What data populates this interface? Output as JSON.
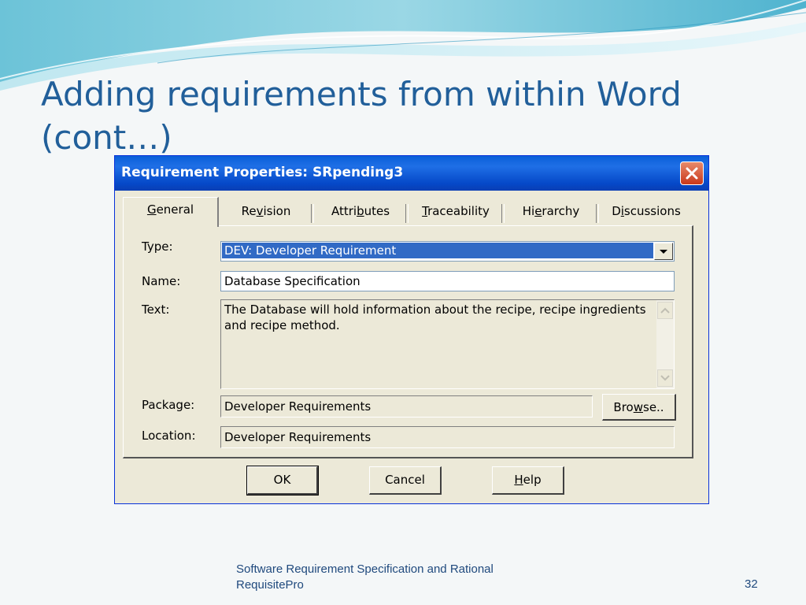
{
  "slide": {
    "title_line1": "Adding requirements from within Word",
    "title_line2": "(cont…)",
    "footer_line1": "Software Requirement Specification and Rational",
    "footer_line2": "RequisitePro",
    "page_number": "32"
  },
  "dialog": {
    "title": "Requirement Properties: SRpending3",
    "tabs": [
      {
        "label": "General",
        "underline": "G",
        "rest": "eneral",
        "pre": ""
      },
      {
        "label": "Revision",
        "pre": "Re",
        "underline": "v",
        "rest": "ision"
      },
      {
        "label": "Attributes",
        "pre": "Attri",
        "underline": "b",
        "rest": "utes"
      },
      {
        "label": "Traceability",
        "pre": "",
        "underline": "T",
        "rest": "raceability"
      },
      {
        "label": "Hierarchy",
        "pre": "Hi",
        "underline": "e",
        "rest": "rarchy"
      },
      {
        "label": "Discussions",
        "pre": "D",
        "underline": "i",
        "rest": "scussions"
      }
    ],
    "fields": {
      "type_label": "Type:",
      "type_value": "DEV: Developer Requirement",
      "name_label": "Name:",
      "name_value": "Database Specification",
      "text_label": "Text:",
      "text_value": "The Database will hold information about the recipe, recipe ingredients and recipe method.",
      "package_label": "Package:",
      "package_value": "Developer Requirements",
      "location_label": "Location:",
      "location_value": "Developer Requirements"
    },
    "buttons": {
      "browse_pre": "Bro",
      "browse_u": "w",
      "browse_rest": "se..",
      "ok": "OK",
      "cancel": "Cancel",
      "help_u": "H",
      "help_rest": "elp"
    }
  },
  "colors": {
    "title_blue": "#215f9a",
    "xp_titlebar": "#0a5fd8",
    "selection": "#316ac5"
  }
}
